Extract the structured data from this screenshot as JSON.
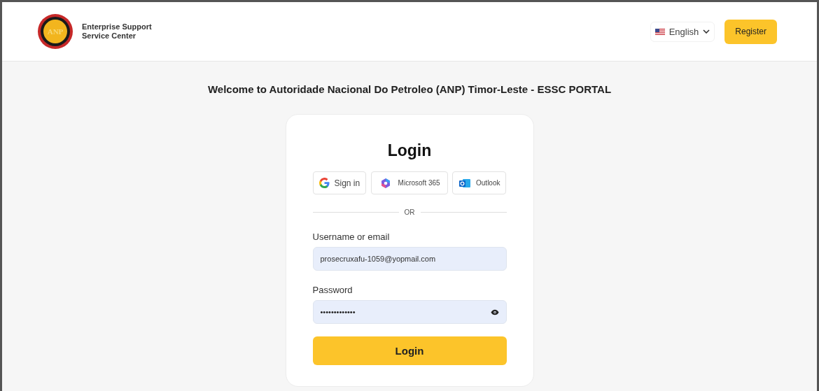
{
  "header": {
    "logo_text": "ANP",
    "brand": "Enterprise Support Service Center",
    "language": "English",
    "register": "Register"
  },
  "welcome": "Welcome to Autoridade Nacional Do Petroleo (ANP) Timor-Leste - ESSC PORTAL",
  "login": {
    "title": "Login",
    "providers": [
      {
        "kind": "google",
        "label": "Sign in"
      },
      {
        "kind": "microsoft365",
        "label": "Microsoft 365"
      },
      {
        "kind": "outlook",
        "label": "Outlook"
      }
    ],
    "divider": "OR",
    "username": {
      "label": "Username or email",
      "value": "prosecruxafu-1059@yopmail.com"
    },
    "password": {
      "label": "Password",
      "value": "•••••••••••••"
    },
    "submit": "Login"
  }
}
